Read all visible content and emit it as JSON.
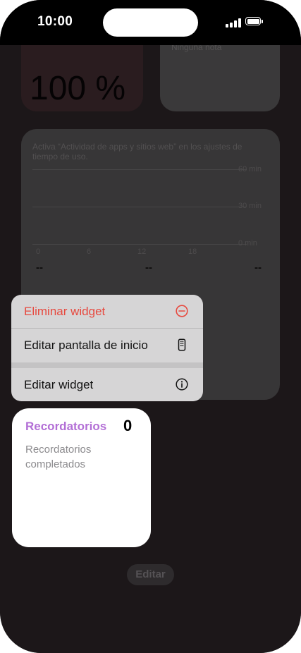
{
  "status_bar": {
    "time": "10:00"
  },
  "widgets": {
    "battery": {
      "percent": "100 %"
    },
    "top_right": {
      "text": "Ninguna nota"
    },
    "screen_time": {
      "message": "Activa “Actividad de apps y sitios web” en los ajustes de tiempo de uso.",
      "y_labels": [
        "60 min",
        "30 min",
        "0 min"
      ],
      "x_labels": [
        "0",
        "6",
        "12",
        "18"
      ],
      "values": [
        "--",
        "--",
        "--"
      ]
    },
    "reminders": {
      "title": "Recordatorios",
      "count": "0",
      "description": "Recordatorios completados",
      "title_color": "#b36fd6"
    }
  },
  "context_menu": {
    "items": [
      {
        "label": "Eliminar widget",
        "icon": "minus-circle-icon",
        "color": "#e7493f"
      },
      {
        "label": "Editar pantalla de inicio",
        "icon": "phone-icon"
      },
      {
        "label": "Editar widget",
        "icon": "info-circle-icon"
      }
    ]
  },
  "edit_button": {
    "label": "Editar"
  }
}
